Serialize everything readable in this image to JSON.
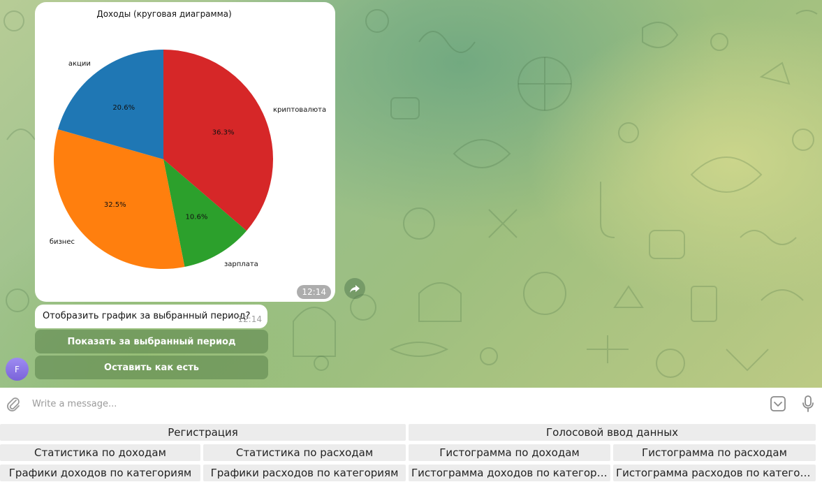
{
  "chat": {
    "chart_image": {
      "time": "12:14",
      "chart_data": {
        "type": "pie",
        "title": "Доходы (круговая диаграмма)",
        "slices": [
          {
            "label": "криптовалюта",
            "value": 36.3,
            "pct_label": "36.3%",
            "color": "#d62728"
          },
          {
            "label": "зарплата",
            "value": 10.6,
            "pct_label": "10.6%",
            "color": "#2ca02c"
          },
          {
            "label": "бизнес",
            "value": 32.5,
            "pct_label": "32.5%",
            "color": "#ff7f0e"
          },
          {
            "label": "акции",
            "value": 20.6,
            "pct_label": "20.6%",
            "color": "#1f77b4"
          }
        ],
        "start_angle_deg": 90,
        "direction": "clockwise"
      }
    },
    "message": {
      "text": "Отобразить график за выбранный период?",
      "time": "12:14"
    },
    "inline_buttons": [
      {
        "label": "Показать за выбранный период"
      },
      {
        "label": "Оставить как есть"
      }
    ],
    "avatar_letter": "F"
  },
  "composer": {
    "placeholder": "Write a message..."
  },
  "reply_keyboard": {
    "registration": "Регистрация",
    "voice_input": "Голосовой ввод данных",
    "income_stats": "Статистика по доходам",
    "expense_stats": "Статистика по расходам",
    "income_histogram": "Гистограмма по доходам",
    "expense_histogram": "Гистограмма по расходам",
    "income_by_category": "Графики доходов по категориям",
    "expense_by_category": "Графики расходов по категориям",
    "income_histogram_by_category": "Гистограмма доходов по категори...",
    "expense_histogram_by_category": "Гистограмма расходов по категори..."
  },
  "colors": {
    "inline_button": "#6f9a5f",
    "keyboard_button": "#ececec",
    "avatar": "#8b76e6"
  }
}
